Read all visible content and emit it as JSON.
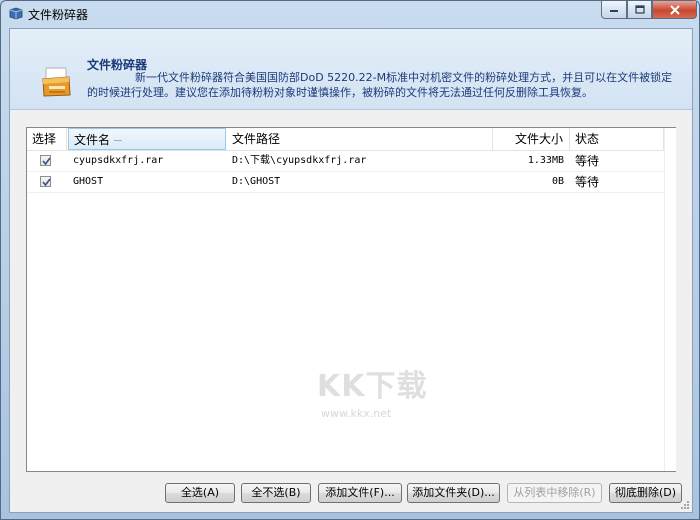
{
  "window": {
    "title": "文件粉碎器",
    "controls": [
      "minimize-icon",
      "maximize-icon",
      "close-icon"
    ]
  },
  "header": {
    "title": "文件粉碎器",
    "description": "新一代文件粉碎器符合美国国防部DoD 5220.22-M标准中对机密文件的粉碎处理方式，并且可以在文件被锁定的时候进行处理。建议您在添加待粉粉对象时谨慎操作，被粉碎的文件将无法通过任何反删除工具恢复。"
  },
  "table": {
    "columns": {
      "select": "选择",
      "name": "文件名",
      "path": "文件路径",
      "size": "文件大小",
      "status": "状态"
    },
    "rows": [
      {
        "checked": true,
        "name": "cyupsdkxfrj.rar",
        "path": "D:\\下载\\cyupsdkxfrj.rar",
        "size": "1.33MB",
        "status": "等待"
      },
      {
        "checked": true,
        "name": "GHOST",
        "path": "D:\\GHOST",
        "size": "0B",
        "status": "等待"
      }
    ]
  },
  "watermark": {
    "main": "KK下载",
    "url": "www.kkx.net"
  },
  "buttons": {
    "select_all": "全选(A)",
    "select_none": "全不选(B)",
    "add_file": "添加文件(F)...",
    "add_folder": "添加文件夹(D)...",
    "remove": "从列表中移除(R)",
    "shred": "彻底删除(D)"
  },
  "colors": {
    "header_text": "#1a3a7a",
    "frame": "#a9c3df",
    "close": "#c7462f"
  }
}
